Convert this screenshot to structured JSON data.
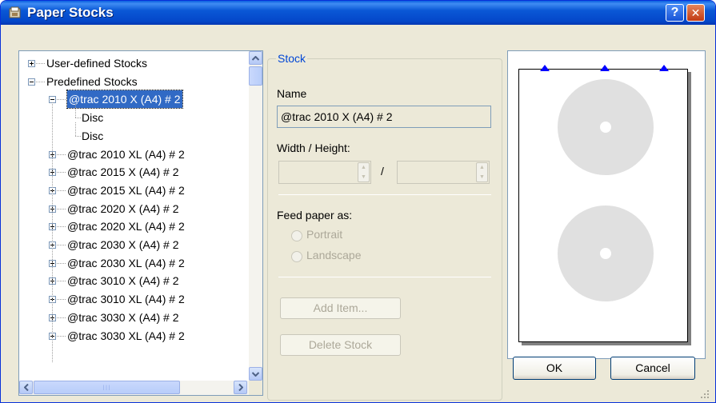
{
  "window": {
    "title": "Paper Stocks",
    "help_glyph": "?",
    "close_glyph": "✕"
  },
  "tree": {
    "items": [
      {
        "label": "User-defined Stocks",
        "expander": "plus"
      },
      {
        "label": "Predefined Stocks",
        "expander": "minus"
      },
      {
        "label": "@trac 2010 X (A4) # 2",
        "expander": "minus",
        "selected": true
      },
      {
        "label": "Disc",
        "expander": "none"
      },
      {
        "label": "Disc",
        "expander": "none"
      },
      {
        "label": "@trac 2010 XL (A4) # 2",
        "expander": "plus"
      },
      {
        "label": "@trac 2015 X (A4) # 2",
        "expander": "plus"
      },
      {
        "label": "@trac 2015 XL (A4) # 2",
        "expander": "plus"
      },
      {
        "label": "@trac 2020 X (A4) # 2",
        "expander": "plus"
      },
      {
        "label": "@trac 2020 XL (A4) # 2",
        "expander": "plus"
      },
      {
        "label": "@trac 2030 X (A4) # 2",
        "expander": "plus"
      },
      {
        "label": "@trac 2030 XL (A4) # 2",
        "expander": "plus"
      },
      {
        "label": "@trac 3010 X (A4) # 2",
        "expander": "plus"
      },
      {
        "label": "@trac 3010 XL (A4) # 2",
        "expander": "plus"
      },
      {
        "label": "@trac 3030 X (A4) # 2",
        "expander": "plus"
      },
      {
        "label": "@trac 3030 XL (A4) # 2",
        "expander": "plus"
      }
    ]
  },
  "stock": {
    "group_title": "Stock",
    "name_label": "Name",
    "name_value": "@trac 2010 X (A4) # 2",
    "size_label": "Width / Height:",
    "size_separator": "/",
    "width_value": "",
    "height_value": "",
    "feed_label": "Feed paper as:",
    "portrait_label": "Portrait",
    "landscape_label": "Landscape",
    "add_item_label": "Add Item...",
    "delete_stock_label": "Delete Stock"
  },
  "preview": {
    "disc_color": "#e0e0e0",
    "marker_color": "#0000ff"
  },
  "buttons": {
    "ok_label": "OK",
    "cancel_label": "Cancel"
  }
}
